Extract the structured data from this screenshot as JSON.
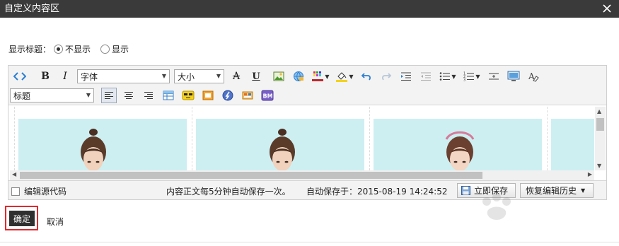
{
  "dialog": {
    "title": "自定义内容区"
  },
  "show_title": {
    "label": "显示标题：",
    "options": [
      {
        "label": "不显示",
        "selected": true
      },
      {
        "label": "显示",
        "selected": false
      }
    ]
  },
  "toolbar": {
    "font_family": "字体",
    "font_size": "大小",
    "heading": "标题",
    "bold": "B",
    "italic": "I",
    "strike": "A",
    "underline": "U",
    "colors": {
      "text_color": "#c0262c",
      "highlight": "#f5d21a",
      "accent": "#2d7fd3"
    }
  },
  "statusbar": {
    "source_code_label": "编辑源代码",
    "autosave_note": "内容正文每5分钟自动保存一次。",
    "saved_at_label": "自动保存于：",
    "saved_at_time": "2015-08-19 14:24:52",
    "save_now": "立即保存",
    "restore_history": "恢复编辑历史"
  },
  "footer": {
    "ok": "确定",
    "cancel": "取消"
  }
}
